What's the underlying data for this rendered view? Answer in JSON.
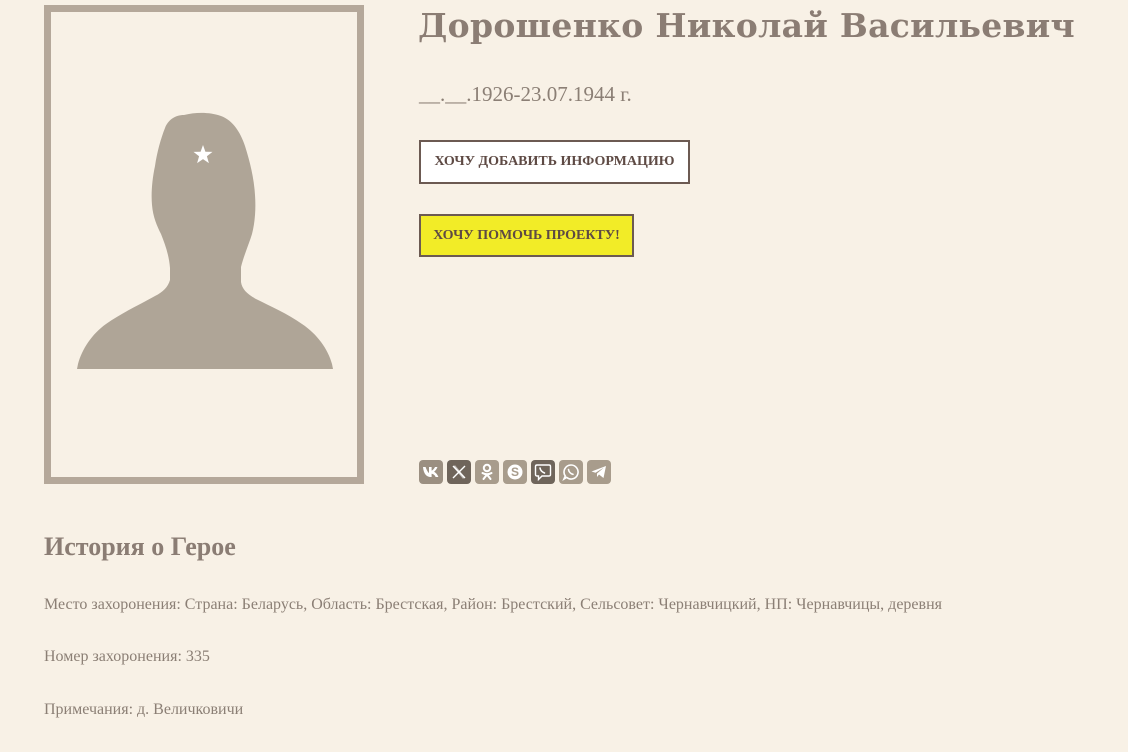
{
  "hero": {
    "name": "Дорошенко Николай Васильевич",
    "dates": "__.__.1926-23.07.1944 г."
  },
  "portrait": {
    "icon": "soldier-silhouette-icon"
  },
  "buttons": {
    "add_info": "ХОЧУ ДОБАВИТЬ ИНФОРМАЦИЮ",
    "help_project": "ХОЧУ ПОМОЧЬ ПРОЕКТУ!"
  },
  "share": [
    {
      "icon": "vk-icon"
    },
    {
      "icon": "x-icon"
    },
    {
      "icon": "odnoklassniki-icon"
    },
    {
      "icon": "skype-icon"
    },
    {
      "icon": "viber-icon"
    },
    {
      "icon": "whatsapp-icon"
    },
    {
      "icon": "telegram-icon"
    }
  ],
  "history": {
    "title": "История о Герое",
    "burial_place": "Место захоронения: Страна: Беларусь, Область: Брестская, Район: Брестский, Сельсовет: Чернавчицкий, НП: Чернавчицы, деревня",
    "burial_number": "Номер захоронения: 335",
    "notes": "Примечания: д. Величковичи"
  },
  "colors": {
    "background": "#f8f1e6",
    "frame": "#b5a89a",
    "silhouette": "#afa597",
    "text": "#8b7f75",
    "help_button": "#f2ec27",
    "button_border": "#6c5a52"
  }
}
